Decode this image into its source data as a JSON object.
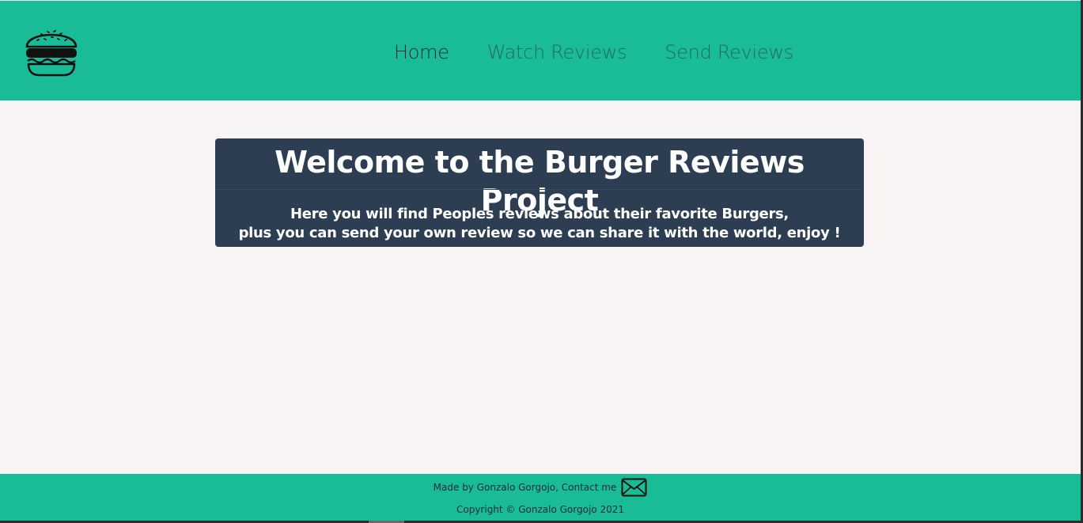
{
  "navbar": {
    "logo_icon": "burger-icon",
    "links": [
      {
        "label": "Home",
        "active": true
      },
      {
        "label": "Watch Reviews",
        "active": false
      },
      {
        "label": "Send Reviews",
        "active": false
      }
    ]
  },
  "hero": {
    "title": "Welcome to the Burger Reviews Project",
    "line1": "Here you will find Peoples reviews about their favorite Burgers,",
    "line2": "plus you can send your own review so we can share it with the world, enjoy !"
  },
  "footer": {
    "made_by": "Made by Gonzalo Gorgojo, Contact me",
    "contact_icon": "mail-icon",
    "copyright": "Copyright © Gonzalo Gorgojo 2021"
  },
  "colors": {
    "accent": "#1abc97",
    "hero_bg": "#2d3d52",
    "page_bg": "#f8f4f3"
  }
}
